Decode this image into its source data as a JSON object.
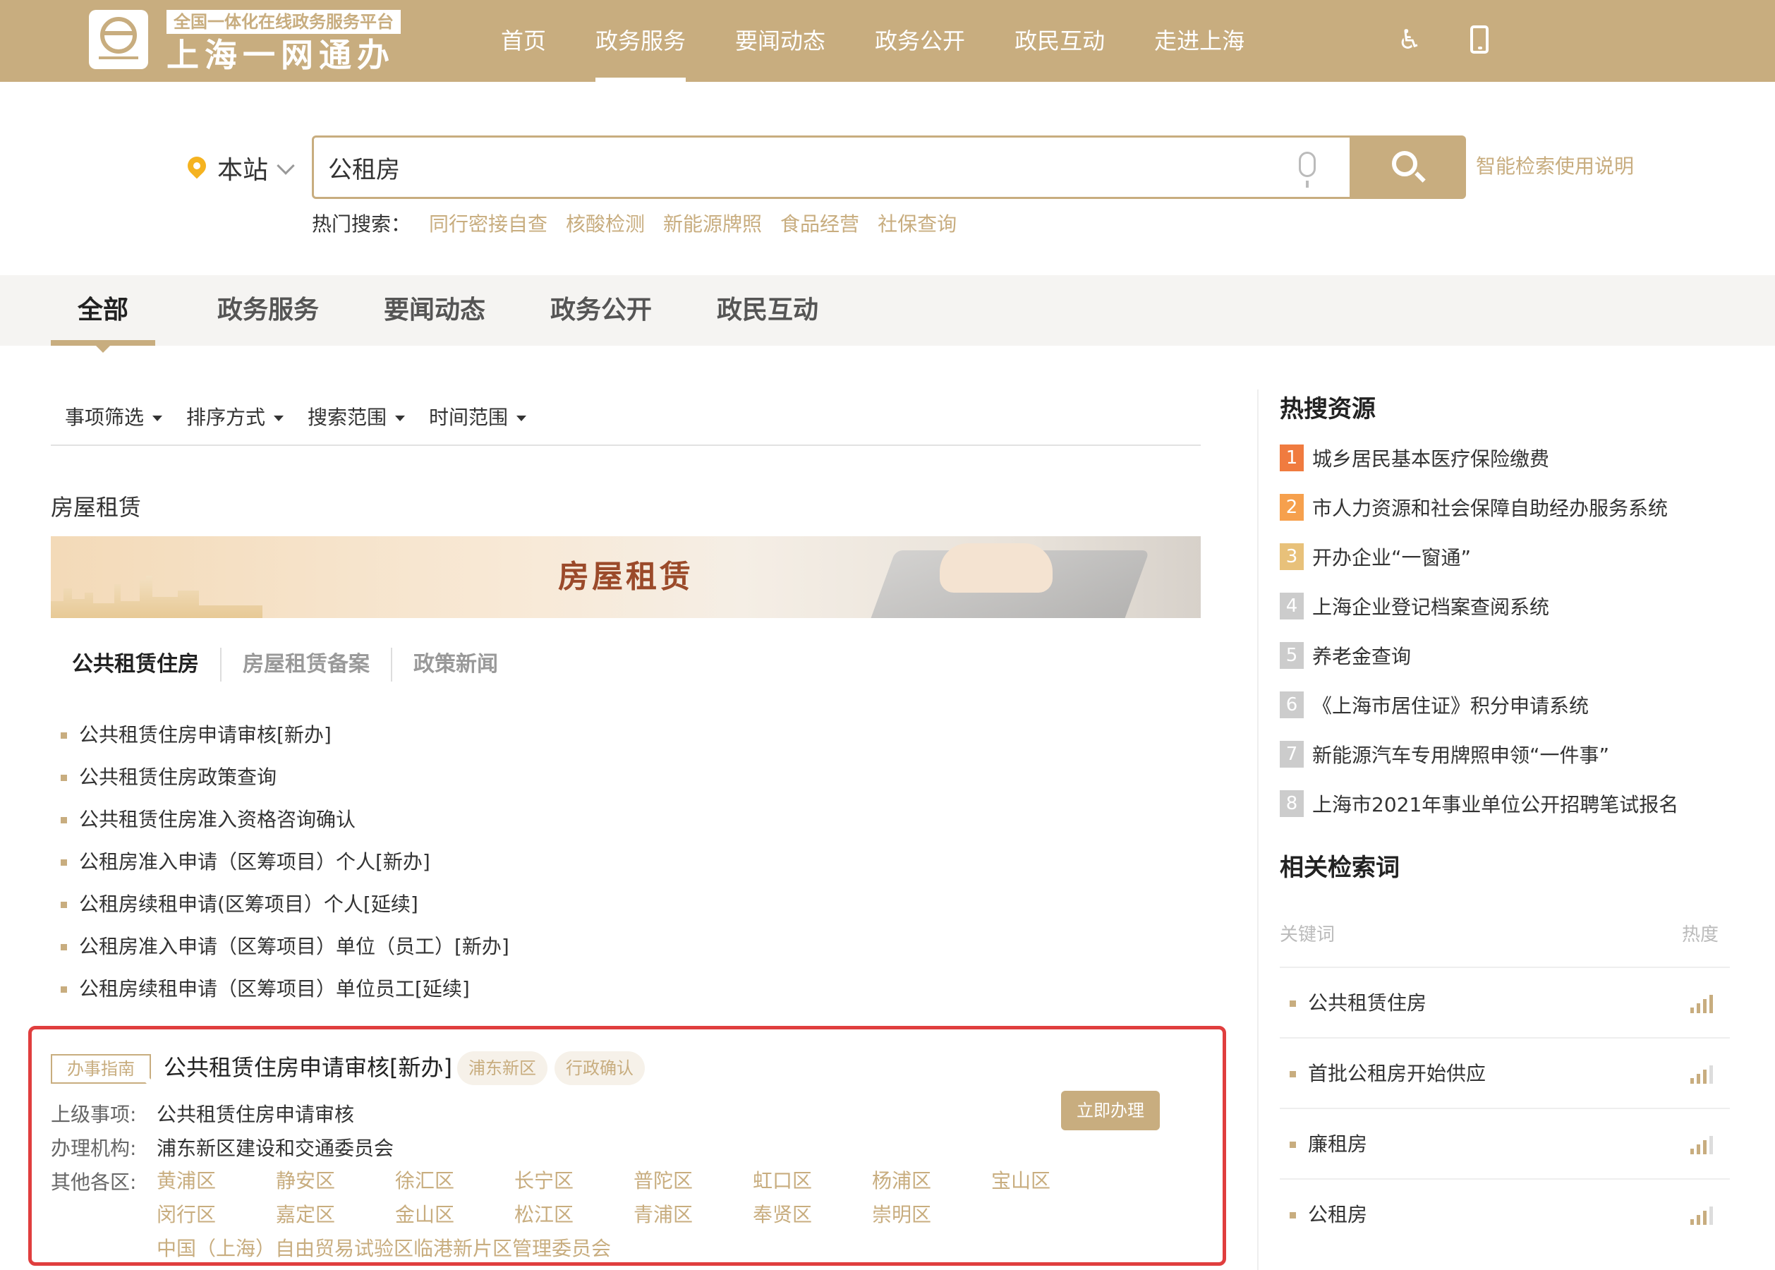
{
  "header": {
    "logo_tag": "全国一体化在线政务服务平台",
    "logo_main": "上海一网通办",
    "nav": [
      "首页",
      "政务服务",
      "要闻动态",
      "政务公开",
      "政民互动",
      "走进上海"
    ],
    "active_nav": "政务服务",
    "accessibility_icon": "accessibility-icon",
    "mobile_icon": "mobile-phone-icon"
  },
  "search": {
    "scope": "本站",
    "query": "公租房",
    "help": "智能检索使用说明",
    "hot_label": "热门搜索：",
    "hot_terms": [
      "同行密接自查",
      "核酸检测",
      "新能源牌照",
      "食品经营",
      "社保查询"
    ]
  },
  "category_tabs": [
    "全部",
    "政务服务",
    "要闻动态",
    "政务公开",
    "政民互动"
  ],
  "filters": [
    "事项筛选",
    "排序方式",
    "搜索范围",
    "时间范围"
  ],
  "section": {
    "title": "房屋租赁",
    "banner_text": "房屋租赁",
    "sub_tabs": [
      "公共租赁住房",
      "房屋租赁备案",
      "政策新闻"
    ],
    "links": [
      "公共租赁住房申请审核[新办]",
      "公共租赁住房政策查询",
      "公共租赁住房准入资格咨询确认",
      "公租房准入申请（区筹项目）个人[新办]",
      "公租房续租申请(区筹项目）个人[延续]",
      "公租房准入申请（区筹项目）单位（员工）[新办]",
      "公租房续租申请（区筹项目）单位员工[延续]"
    ]
  },
  "result": {
    "tag": "办事指南",
    "title": "公共租赁住房申请审核[新办]",
    "pills": [
      "浦东新区",
      "行政确认"
    ],
    "parent_label": "上级事项:",
    "parent_value": "公共租赁住房申请审核",
    "agency_label": "办理机构:",
    "agency_value": "浦东新区建设和交通委员会",
    "districts_label": "其他各区:",
    "apply": "立即办理",
    "districts_row1": [
      "黄浦区",
      "静安区",
      "徐汇区",
      "长宁区",
      "普陀区",
      "虹口区",
      "杨浦区",
      "宝山区"
    ],
    "districts_row2": [
      "闵行区",
      "嘉定区",
      "金山区",
      "松江区",
      "青浦区",
      "奉贤区",
      "崇明区"
    ],
    "districts_row3": "中国（上海）自由贸易试验区临港新片区管理委员会"
  },
  "sidebar": {
    "hot_title": "热搜资源",
    "hot_items": [
      {
        "rank": "1",
        "text": "城乡居民基本医疗保险缴费"
      },
      {
        "rank": "2",
        "text": "市人力资源和社会保障自助经办服务系统"
      },
      {
        "rank": "3",
        "text": "开办企业“一窗通”"
      },
      {
        "rank": "4",
        "text": "上海企业登记档案查阅系统"
      },
      {
        "rank": "5",
        "text": "养老金查询"
      },
      {
        "rank": "6",
        "text": "《上海市居住证》积分申请系统"
      },
      {
        "rank": "7",
        "text": "新能源汽车专用牌照申领“一件事”"
      },
      {
        "rank": "8",
        "text": "上海市2021年事业单位公开招聘笔试报名"
      }
    ],
    "related_title": "相关检索词",
    "kw_col_left": "关键词",
    "kw_col_right": "热度",
    "keywords": [
      {
        "text": "公共租赁住房",
        "heat": 4
      },
      {
        "text": "首批公租房开始供应",
        "heat": 3
      },
      {
        "text": "廉租房",
        "heat": 3
      },
      {
        "text": "公租房",
        "heat": 3
      }
    ]
  },
  "colors": {
    "brand": "#c8ad7f",
    "highlight_border": "#e03e3e",
    "rank1": "#f07b3f",
    "rank2": "#f6a04d",
    "rank3": "#e8c17a"
  }
}
